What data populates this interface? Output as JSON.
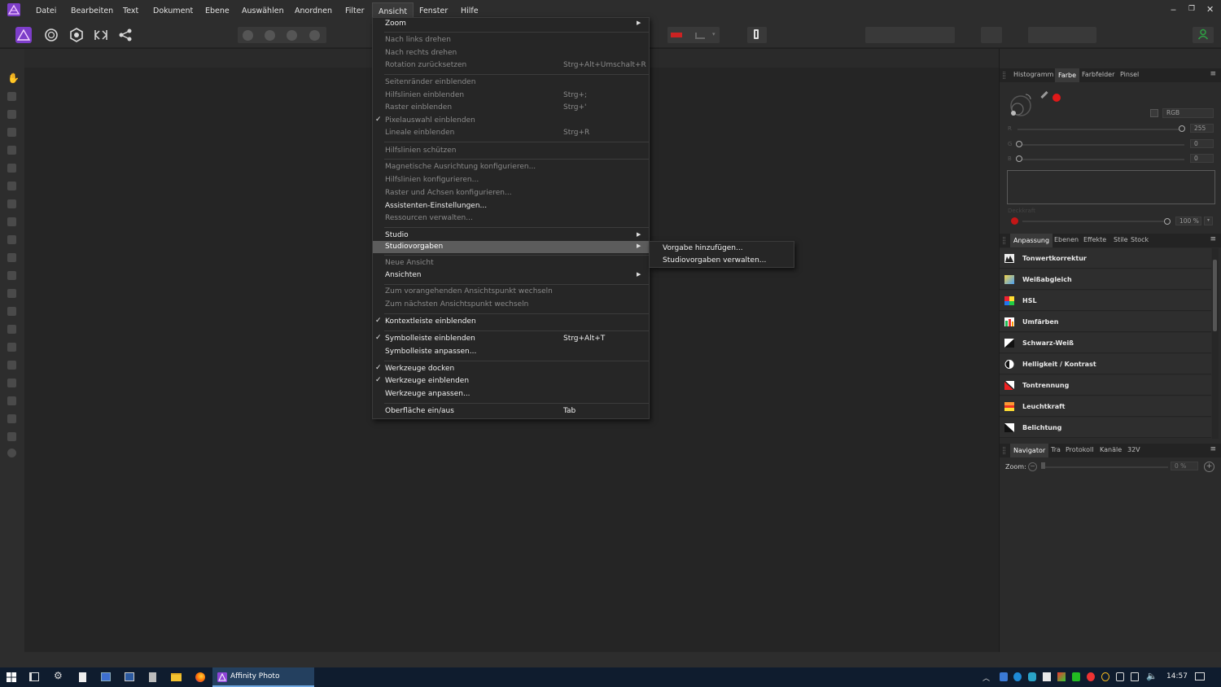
{
  "menubar": {
    "items": [
      "Datei",
      "Bearbeiten",
      "Text",
      "Dokument",
      "Ebene",
      "Auswählen",
      "Anordnen",
      "Filter",
      "Ansicht",
      "Fenster",
      "Hilfe"
    ],
    "open_item": "Ansicht",
    "window_controls": {
      "minimize": "‒",
      "restore": "❐",
      "close": "✕"
    }
  },
  "view_menu": [
    {
      "label": "Zoom",
      "state": "enabled",
      "submenu": true
    },
    {
      "label": "Nach links drehen",
      "state": "disabled"
    },
    {
      "label": "Nach rechts drehen",
      "state": "disabled"
    },
    {
      "label": "Rotation zurücksetzen",
      "state": "disabled",
      "shortcut": "Strg+Alt+Umschalt+R"
    },
    {
      "label": "Seitenränder einblenden",
      "state": "disabled"
    },
    {
      "label": "Hilfslinien einblenden",
      "state": "disabled",
      "shortcut": "Strg+;"
    },
    {
      "label": "Raster einblenden",
      "state": "disabled",
      "shortcut": "Strg+'"
    },
    {
      "label": "Pixelauswahl einblenden",
      "state": "disabled",
      "checked": true
    },
    {
      "label": "Lineale einblenden",
      "state": "disabled",
      "shortcut": "Strg+R"
    },
    {
      "label": "Hilfslinien schützen",
      "state": "disabled"
    },
    {
      "label": "Magnetische Ausrichtung konfigurieren...",
      "state": "disabled"
    },
    {
      "label": "Hilfslinien konfigurieren...",
      "state": "disabled"
    },
    {
      "label": "Raster und Achsen konfigurieren...",
      "state": "disabled"
    },
    {
      "label": "Assistenten-Einstellungen...",
      "state": "enabled"
    },
    {
      "label": "Ressourcen verwalten...",
      "state": "disabled"
    },
    {
      "label": "Studio",
      "state": "enabled",
      "submenu": true
    },
    {
      "label": "Studiovorgaben",
      "state": "highlighted",
      "submenu": true
    },
    {
      "label": "Neue Ansicht",
      "state": "disabled"
    },
    {
      "label": "Ansichten",
      "state": "enabled",
      "submenu": true
    },
    {
      "label": "Zum vorangehenden Ansichtspunkt wechseln",
      "state": "disabled"
    },
    {
      "label": "Zum nächsten Ansichtspunkt wechseln",
      "state": "disabled"
    },
    {
      "label": "Kontextleiste einblenden",
      "state": "enabled",
      "checked": true
    },
    {
      "label": "Symbolleiste einblenden",
      "state": "enabled",
      "checked": true,
      "shortcut": "Strg+Alt+T"
    },
    {
      "label": "Symbolleiste anpassen...",
      "state": "enabled"
    },
    {
      "label": "Werkzeuge docken",
      "state": "enabled",
      "checked": true
    },
    {
      "label": "Werkzeuge einblenden",
      "state": "enabled",
      "checked": true
    },
    {
      "label": "Werkzeuge anpassen...",
      "state": "enabled"
    },
    {
      "label": "Oberfläche ein/aus",
      "state": "enabled",
      "shortcut": "Tab"
    }
  ],
  "studiovorgaben_submenu": [
    "Vorgabe hinzufügen...",
    "Studiovorgaben verwalten..."
  ],
  "color_panel": {
    "tabs": [
      "Histogramm",
      "Farbe",
      "Farbfelder",
      "Pinsel"
    ],
    "active_tab": "Farbe",
    "mode": "RGB",
    "sliders": [
      {
        "label": "R",
        "value": "255"
      },
      {
        "label": "G",
        "value": "0"
      },
      {
        "label": "B",
        "value": "0"
      }
    ],
    "opacity_label": "Deckkraft",
    "opacity_value": "100 %"
  },
  "adjustments_panel": {
    "tabs": [
      "Anpassung",
      "Ebenen",
      "Effekte",
      "Stile",
      "Stock"
    ],
    "active_tab": "Anpassung",
    "items": [
      "Tonwertkorrektur",
      "Weißabgleich",
      "HSL",
      "Umfärben",
      "Schwarz-Weiß",
      "Helligkeit / Kontrast",
      "Tontrennung",
      "Leuchtkraft",
      "Belichtung"
    ]
  },
  "navigator_panel": {
    "tabs": [
      "Navigator",
      "Tra",
      "Protokoll",
      "Kanäle",
      "32V"
    ],
    "active_tab": "Navigator",
    "zoom_label": "Zoom:",
    "zoom_value": "0 %"
  },
  "taskbar": {
    "app_label": "Affinity Photo",
    "time": "14:57"
  },
  "colors": {
    "accent_purple": "#8e44d8",
    "menu_highlight": "#5c5c5c",
    "persona_green": "#2ea043",
    "color_red": "#e01919"
  }
}
